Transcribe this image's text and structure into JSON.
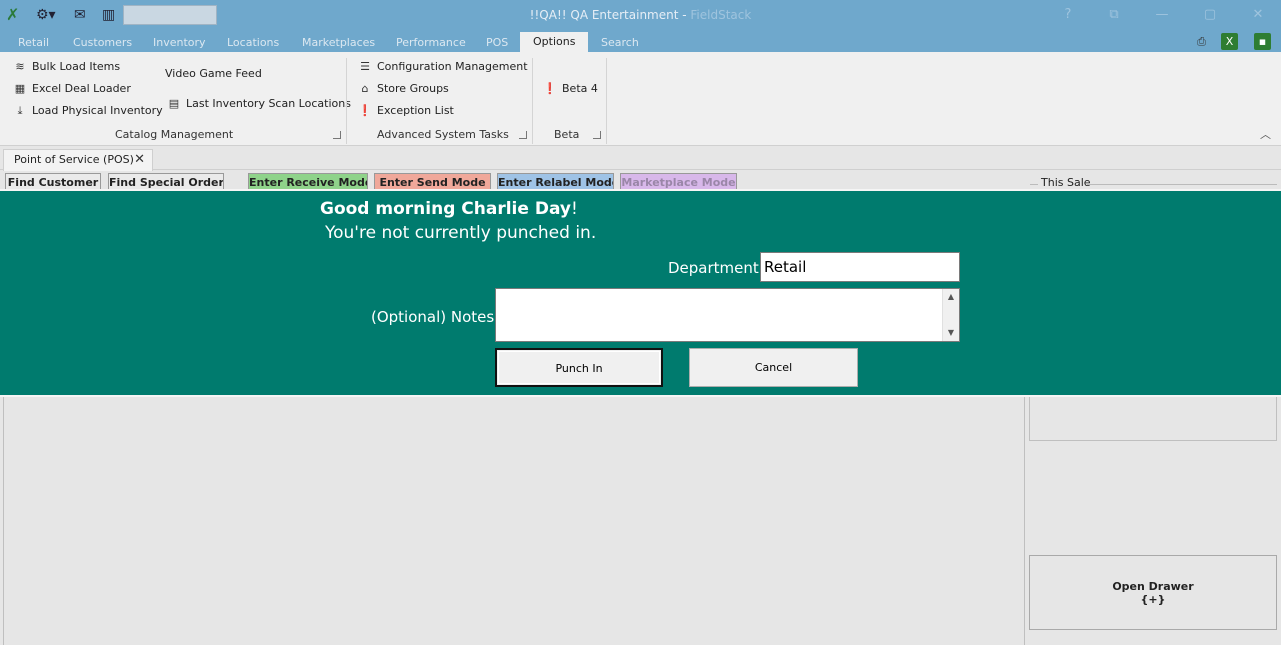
{
  "titlebar": {
    "title_main": "!!QA!! QA Entertainment - ",
    "title_app": "FieldStack",
    "help": "?",
    "restore_icon": "window-restore-icon",
    "minimize": "—",
    "maximize": "▢",
    "close": "✕"
  },
  "ribbon_tabs": [
    "Retail",
    "Customers",
    "Inventory",
    "Locations",
    "Marketplaces",
    "Performance",
    "POS",
    "Options",
    "Search"
  ],
  "ribbon_active_tab": "Options",
  "ribbon": {
    "catalog": {
      "label": "Catalog Management",
      "items": [
        "Bulk Load Items",
        "Excel Deal Loader",
        "Load Physical Inventory",
        "Video Game Feed",
        "Last Inventory Scan Locations"
      ]
    },
    "advanced": {
      "label": "Advanced System Tasks",
      "items": [
        "Configuration Management",
        "Store Groups",
        "Exception List"
      ]
    },
    "beta": {
      "label": "Beta",
      "items": [
        "Beta 4"
      ]
    }
  },
  "doc_tab": {
    "label": "Point of Service (POS)",
    "close": "✕"
  },
  "toolbar": {
    "find_customer": "Find Customer",
    "find_special_order": "Find Special Order",
    "enter_receive": "Enter Receive Mode",
    "enter_send": "Enter Send Mode",
    "enter_relabel": "Enter Relabel Mode",
    "marketplace": "Marketplace Mode"
  },
  "colors": {
    "receive": "#8fd38a",
    "send": "#f0a89a",
    "relabel": "#9fc3e6",
    "marketplace": "#d8b8ea",
    "overlay": "#007b6e"
  },
  "this_sale": "This Sale",
  "open_drawer": {
    "line1": "Open Drawer",
    "line2": "{+}"
  },
  "punch": {
    "greeting_prefix": "Good morning ",
    "user_name": "Charlie  Day",
    "greeting_suffix": "!",
    "status": "You're not currently punched in.",
    "department_label": "Department:",
    "department_value": "Retail",
    "notes_label": "(Optional) Notes:",
    "notes_value": "",
    "punch_in": "Punch In",
    "cancel": "Cancel"
  }
}
